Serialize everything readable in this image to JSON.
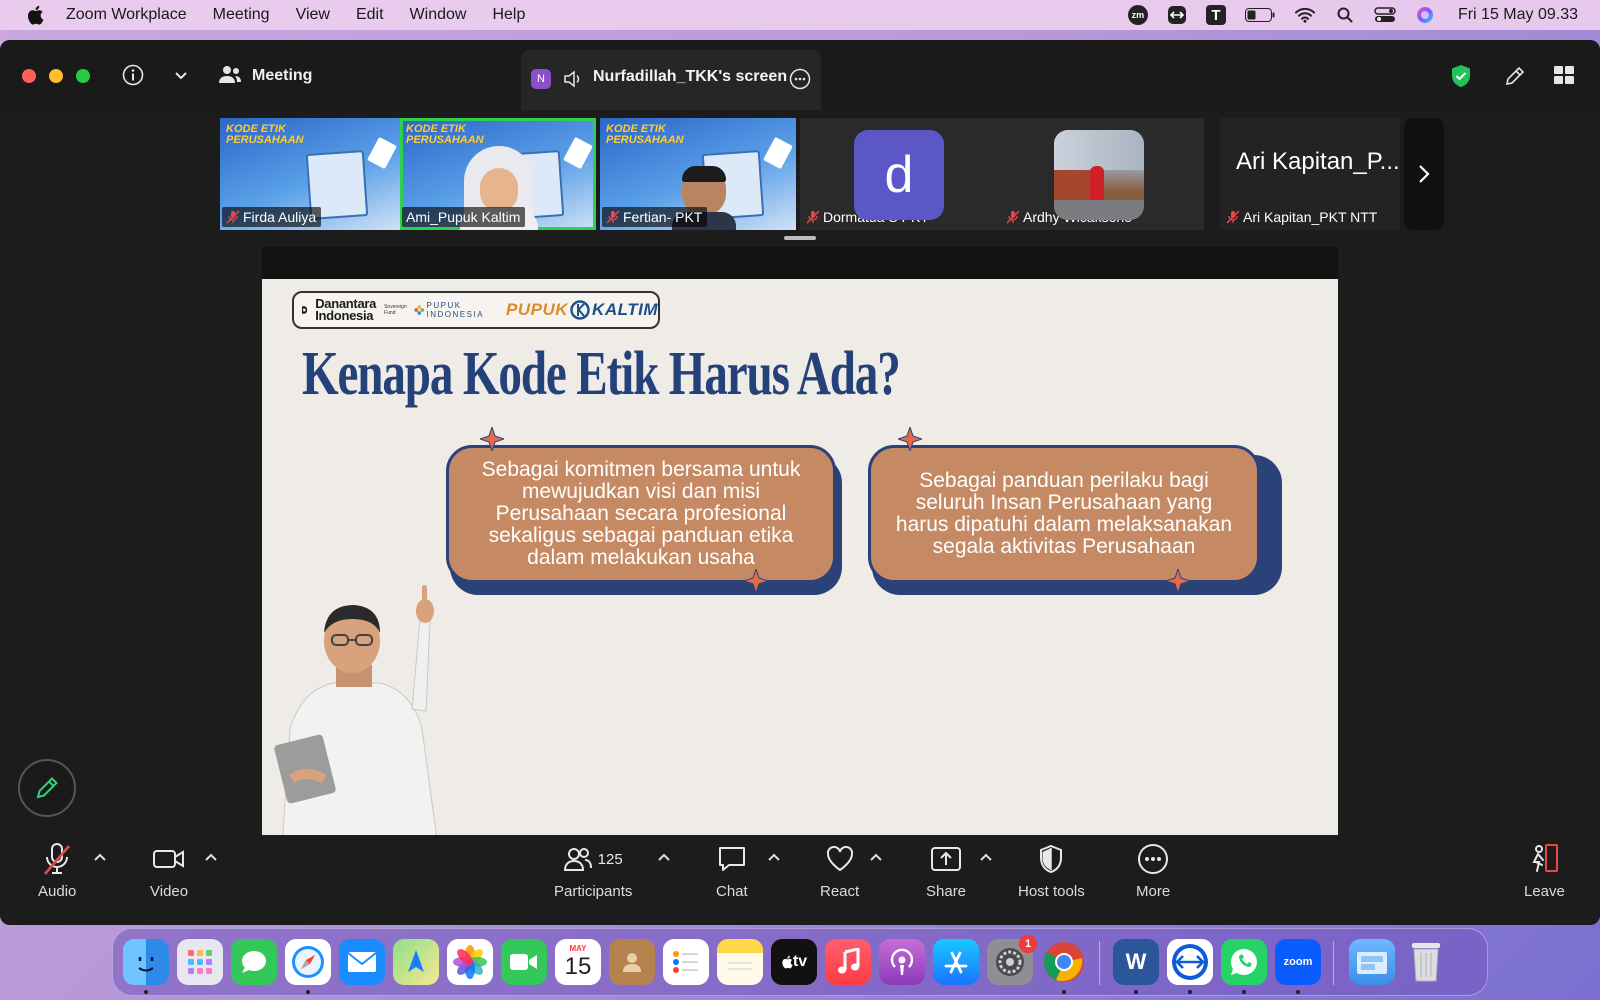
{
  "menubar": {
    "app_name": "Zoom Workplace",
    "items": [
      "Meeting",
      "View",
      "Edit",
      "Window",
      "Help"
    ],
    "status_icons": [
      "zoom-mark-icon",
      "teamviewer-icon",
      "text-t-icon",
      "battery-icon",
      "wifi-icon",
      "spotlight-search-icon",
      "control-center-icon",
      "siri-icon"
    ],
    "status_zm": "zm",
    "status_t": "T",
    "datetime": "Fri 15 May  09.33"
  },
  "window": {
    "meeting_label": "Meeting",
    "share_badge": "N",
    "share_title": "Nurfadillah_TKK's screen"
  },
  "participants": [
    {
      "name": "Firda Auliya",
      "muted": true,
      "tile": "slide"
    },
    {
      "name": "Ami_Pupuk Kaltim",
      "muted": false,
      "tile": "video",
      "active": true
    },
    {
      "name": "Fertian- PKT",
      "muted": true,
      "tile": "video"
    },
    {
      "name": "Dormatua S PKT",
      "muted": true,
      "tile": "avatar",
      "avatar_letter": "d"
    },
    {
      "name": "Ardhy Wicaksono",
      "muted": true,
      "tile": "photo"
    },
    {
      "name": "Ari Kapitan_PKT NTT",
      "muted": true,
      "tile": "name",
      "display_name": "Ari Kapitan_P..."
    }
  ],
  "tile_caption": "KODE ETIK PERUSAHAAN",
  "slide": {
    "logo_danantara_1": "Danantara",
    "logo_danantara_2": "Indonesia",
    "logo_danantara_sub": "Sovereign Fund",
    "logo_pupuk_indonesia_1": "PUPUK",
    "logo_pupuk_indonesia_2": "INDONESIA",
    "logo_pupuk_kaltim_1": "PUPUK",
    "logo_pupuk_kaltim_2": "KALTIM",
    "title": "Kenapa Kode Etik Harus Ada?",
    "card_left": "Sebagai komitmen bersama untuk mewujudkan visi dan misi Perusahaan secara profesional sekaligus sebagai panduan etika dalam melakukan usaha",
    "card_right": "Sebagai panduan perilaku bagi seluruh Insan Perusahaan yang harus dipatuhi dalam melaksanakan segala aktivitas Perusahaan",
    "colors": {
      "title": "#24417a",
      "card": "#c58a63",
      "card_border": "#2b4278",
      "sparkle": "#e06a4a"
    }
  },
  "toolbar": {
    "audio": "Audio",
    "video": "Video",
    "participants": "Participants",
    "participants_count": "125",
    "chat": "Chat",
    "react": "React",
    "share": "Share",
    "host_tools": "Host tools",
    "more": "More",
    "leave": "Leave"
  },
  "dock": {
    "apps": [
      "Finder",
      "Launchpad",
      "Messages",
      "Safari",
      "Mail",
      "Maps",
      "Photos",
      "FaceTime",
      "Calendar",
      "Contacts",
      "Reminders",
      "Notes",
      "Apple TV",
      "Music",
      "Podcasts",
      "App Store",
      "System Settings",
      "Google Chrome",
      "Microsoft Word",
      "TeamViewer",
      "WhatsApp",
      "Zoom",
      "Downloads",
      "Trash"
    ],
    "calendar_month": "MAY",
    "calendar_day": "15",
    "settings_badge": "1",
    "tv_label": "tv",
    "word_label": "W",
    "zoom_label": "zoom"
  },
  "accent_colors": {
    "active_speaker": "#2ed04e",
    "avatar": "#5b57c6",
    "muted": "#e5484d"
  }
}
